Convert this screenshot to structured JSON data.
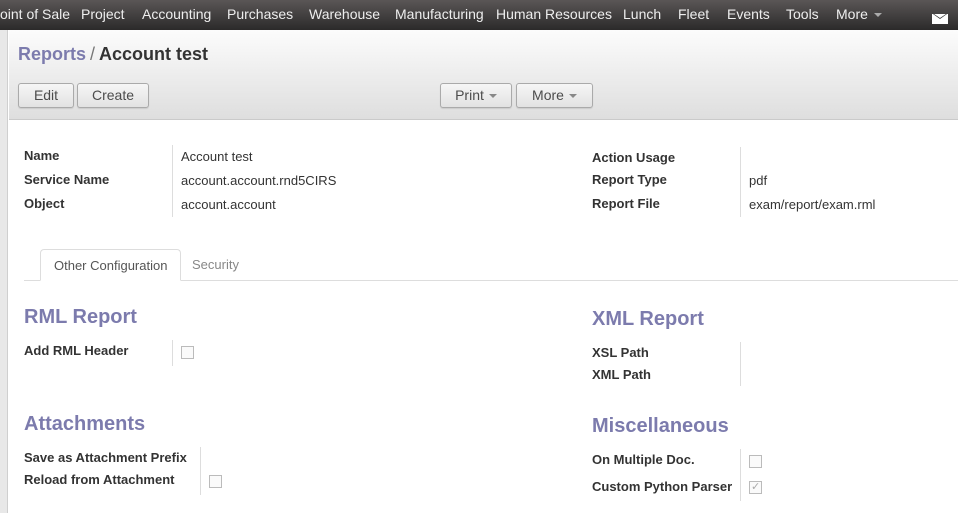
{
  "topbar": {
    "menu": [
      {
        "label": "oint of Sale"
      },
      {
        "label": "Project"
      },
      {
        "label": "Accounting"
      },
      {
        "label": "Purchases"
      },
      {
        "label": "Warehouse"
      },
      {
        "label": "Manufacturing"
      },
      {
        "label": "Human Resources"
      },
      {
        "label": "Lunch"
      },
      {
        "label": "Fleet"
      },
      {
        "label": "Events"
      },
      {
        "label": "Tools"
      },
      {
        "label": "More"
      }
    ],
    "mail_icon": "envelope-icon"
  },
  "header": {
    "breadcrumb_parent": "Reports",
    "breadcrumb_sep": "/",
    "breadcrumb_current": "Account test",
    "buttons": {
      "edit": "Edit",
      "create": "Create",
      "print": "Print",
      "more": "More"
    }
  },
  "form": {
    "left_fields": [
      {
        "label": "Name",
        "value": "Account test"
      },
      {
        "label": "Service Name",
        "value": "account.account.rnd5CIRS"
      },
      {
        "label": "Object",
        "value": "account.account"
      }
    ],
    "right_fields": [
      {
        "label": "Action Usage",
        "value": ""
      },
      {
        "label": "Report Type",
        "value": "pdf"
      },
      {
        "label": "Report File",
        "value": "exam/report/exam.rml"
      }
    ],
    "tabs": [
      {
        "label": "Other Configuration",
        "active": true
      },
      {
        "label": "Security",
        "active": false
      }
    ],
    "rml_report": {
      "title": "RML Report",
      "add_rml_header_label": "Add RML Header",
      "add_rml_header_checked": false
    },
    "xml_report": {
      "title": "XML Report",
      "xsl_path_label": "XSL Path",
      "xml_path_label": "XML Path"
    },
    "attachments": {
      "title": "Attachments",
      "prefix_label": "Save as Attachment Prefix",
      "reload_label": "Reload from Attachment",
      "reload_checked": false
    },
    "misc": {
      "title": "Miscellaneous",
      "multiple_doc_label": "On Multiple Doc.",
      "multiple_doc_checked": false,
      "custom_parser_label": "Custom Python Parser",
      "custom_parser_checked": true
    }
  }
}
